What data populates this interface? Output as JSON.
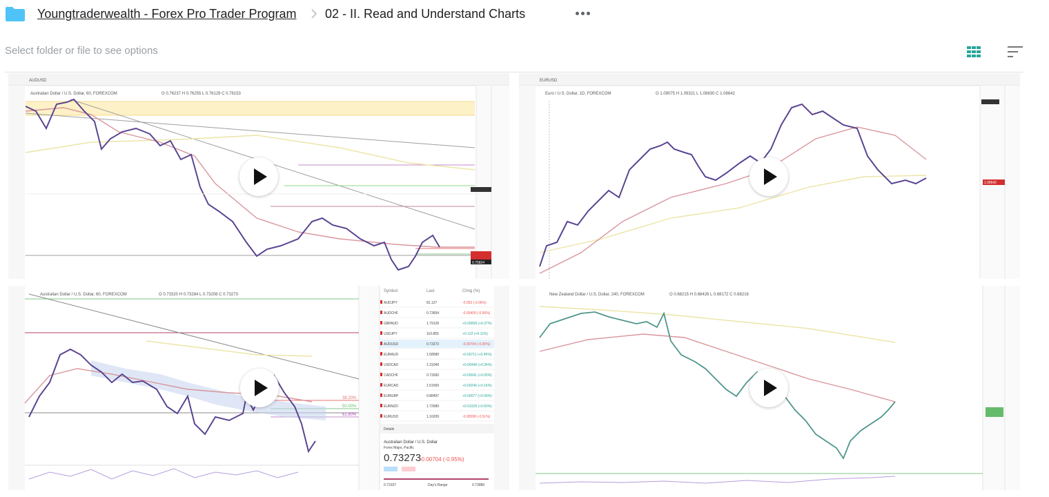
{
  "header": {
    "folder_icon": "folder-icon",
    "breadcrumb_root": "Youngtraderwealth - Forex Pro Trader Program",
    "breadcrumb_separator_icon": "chevron-right-icon",
    "breadcrumb_current": "02 - II. Read and Understand Charts",
    "more_icon": "more-horizontal-icon"
  },
  "toolbar": {
    "hint": "Select folder or file to see options",
    "grid_view_icon": "grid-view-icon",
    "sort_icon": "sort-icon"
  },
  "colors": {
    "folder": "#4fc3f7",
    "grid_icon": "#26a69a",
    "play": "#111111"
  },
  "tiles": [
    {
      "symbol": "AUDUSD",
      "legend": "Australian Dollar / U.S. Dollar, 60, FOREXCOM",
      "ohlc": "O 0.76237 H 0.76255 L 0.76129 C 0.76153",
      "last_price": "0.75824",
      "play_icon": "play-icon"
    },
    {
      "symbol": "EURUSD",
      "legend": "Euro / U.S. Dollar, 1D, FOREXCOM",
      "ohlc": "O 1.09075 H 1.09321 L 1.08830 C 1.08642",
      "last_price": "1.08642",
      "play_icon": "play-icon"
    },
    {
      "legend": "Australian Dollar / U.S. Dollar, 60, FOREXCOM",
      "ohlc": "O 0.73320 H 0.73284 L 0.73208 C 0.73273",
      "watchlist": {
        "headers": [
          "Symbol",
          "Last",
          "Chng (%)"
        ],
        "rows": [
          [
            "AUDJPY",
            "81.127",
            "-0.053 (-0.06%)"
          ],
          [
            "AUDCHF",
            "0.73654",
            "-0.00409 (-0.56%)"
          ],
          [
            "GBPAUD",
            "1.79139",
            "+0.00658 (+0.37%)"
          ],
          [
            "USDJPY",
            "110.855",
            "+0.122 (+0.11%)"
          ],
          [
            "AUDUSD",
            "0.73273",
            "-0.00704 (-0.95%)"
          ],
          [
            "EURAUD",
            "1.58589",
            "+0.00711 (+0.45%)"
          ],
          [
            "USDCAD",
            "1.31049",
            "+0.00448 (+0.34%)"
          ],
          [
            "CADCHF",
            "0.73260",
            "+0.00041 (+0.05%)"
          ],
          [
            "EURCAD",
            "1.51569",
            "+0.00246 (+0.16%)"
          ],
          [
            "EURGBP",
            "0.88497",
            "+0.00077 (+0.09%)"
          ],
          [
            "EURNZD",
            "1.72589",
            "+0.01028 (+0.60%)"
          ],
          [
            "EURUSD",
            "1.16209",
            "-0.00598 (-0.51%)"
          ]
        ]
      },
      "details_label": "Details",
      "detail_name": "Australian Dollar / U.S. Dollar",
      "detail_sub": "Forex Major, Pacific",
      "detail_price": "0.73273",
      "detail_change": "-0.00704 (-0.95%)",
      "range_low": "0.73107",
      "range_label": "Day's Range",
      "range_high": "0.73989",
      "fib_1": "38.20%",
      "fib_2": "50.00%",
      "fib_3": "61.80%",
      "play_icon": "play-icon"
    },
    {
      "legend": "New Zealand Dollar / U.S. Dollar, 240, FOREXCOM",
      "ohlc": "O 0.68215 H 0.68426 L 0.68172 C 0.68216",
      "play_icon": "play-icon"
    }
  ]
}
